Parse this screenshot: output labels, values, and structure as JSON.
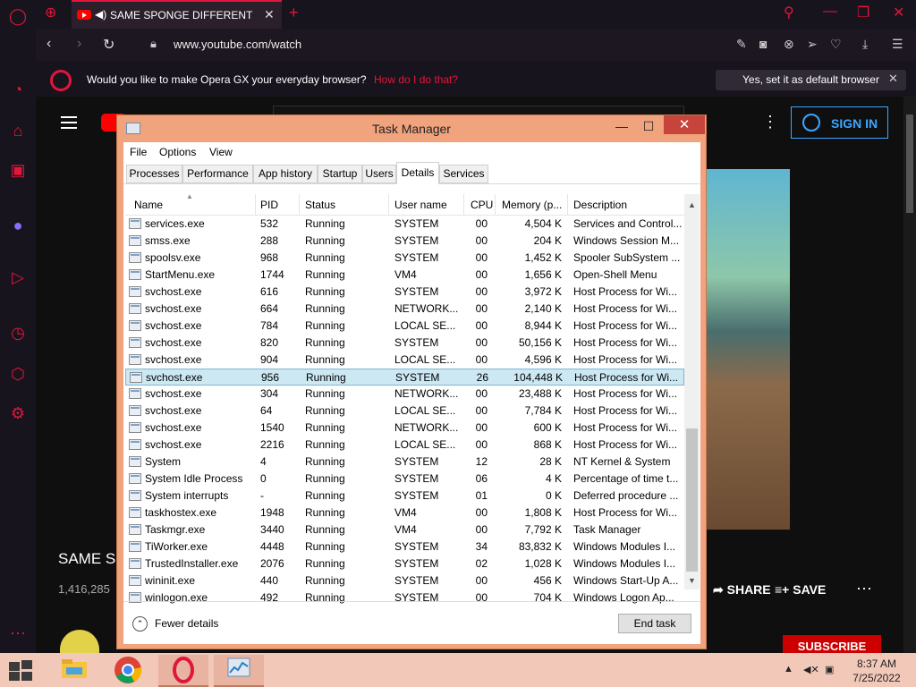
{
  "browser": {
    "tab_title": "SAME SPONGE DIFFERENT",
    "url": "www.youtube.com/watch",
    "infobar_text": "Would you like to make Opera GX your everyday browser?",
    "infobar_link": "How do I do that?",
    "infobar_button": "Yes, set it as default browser"
  },
  "youtube": {
    "signin": "SIGN IN",
    "video_title": "SAME S",
    "views": "1,416,285",
    "share": "SHARE",
    "save": "SAVE",
    "subscribe": "SUBSCRIBE"
  },
  "taskmanager": {
    "title": "Task Manager",
    "menus": [
      "File",
      "Options",
      "View"
    ],
    "tabs": [
      "Processes",
      "Performance",
      "App history",
      "Startup",
      "Users",
      "Details",
      "Services"
    ],
    "active_tab": "Details",
    "columns": [
      "Name",
      "PID",
      "Status",
      "User name",
      "CPU",
      "Memory (p...",
      "Description"
    ],
    "rows": [
      [
        "services.exe",
        "532",
        "Running",
        "SYSTEM",
        "00",
        "4,504 K",
        "Services and Control..."
      ],
      [
        "smss.exe",
        "288",
        "Running",
        "SYSTEM",
        "00",
        "204 K",
        "Windows Session M..."
      ],
      [
        "spoolsv.exe",
        "968",
        "Running",
        "SYSTEM",
        "00",
        "1,452 K",
        "Spooler SubSystem ..."
      ],
      [
        "StartMenu.exe",
        "1744",
        "Running",
        "VM4",
        "00",
        "1,656 K",
        "Open-Shell Menu"
      ],
      [
        "svchost.exe",
        "616",
        "Running",
        "SYSTEM",
        "00",
        "3,972 K",
        "Host Process for Wi..."
      ],
      [
        "svchost.exe",
        "664",
        "Running",
        "NETWORK...",
        "00",
        "2,140 K",
        "Host Process for Wi..."
      ],
      [
        "svchost.exe",
        "784",
        "Running",
        "LOCAL SE...",
        "00",
        "8,944 K",
        "Host Process for Wi..."
      ],
      [
        "svchost.exe",
        "820",
        "Running",
        "SYSTEM",
        "00",
        "50,156 K",
        "Host Process for Wi..."
      ],
      [
        "svchost.exe",
        "904",
        "Running",
        "LOCAL SE...",
        "00",
        "4,596 K",
        "Host Process for Wi..."
      ],
      [
        "svchost.exe",
        "956",
        "Running",
        "SYSTEM",
        "26",
        "104,448 K",
        "Host Process for Wi..."
      ],
      [
        "svchost.exe",
        "304",
        "Running",
        "NETWORK...",
        "00",
        "23,488 K",
        "Host Process for Wi..."
      ],
      [
        "svchost.exe",
        "64",
        "Running",
        "LOCAL SE...",
        "00",
        "7,784 K",
        "Host Process for Wi..."
      ],
      [
        "svchost.exe",
        "1540",
        "Running",
        "NETWORK...",
        "00",
        "600 K",
        "Host Process for Wi..."
      ],
      [
        "svchost.exe",
        "2216",
        "Running",
        "LOCAL SE...",
        "00",
        "868 K",
        "Host Process for Wi..."
      ],
      [
        "System",
        "4",
        "Running",
        "SYSTEM",
        "12",
        "28 K",
        "NT Kernel & System"
      ],
      [
        "System Idle Process",
        "0",
        "Running",
        "SYSTEM",
        "06",
        "4 K",
        "Percentage of time t..."
      ],
      [
        "System interrupts",
        "-",
        "Running",
        "SYSTEM",
        "01",
        "0 K",
        "Deferred procedure ..."
      ],
      [
        "taskhostex.exe",
        "1948",
        "Running",
        "VM4",
        "00",
        "1,808 K",
        "Host Process for Wi..."
      ],
      [
        "Taskmgr.exe",
        "3440",
        "Running",
        "VM4",
        "00",
        "7,792 K",
        "Task Manager"
      ],
      [
        "TiWorker.exe",
        "4448",
        "Running",
        "SYSTEM",
        "34",
        "83,832 K",
        "Windows Modules I..."
      ],
      [
        "TrustedInstaller.exe",
        "2076",
        "Running",
        "SYSTEM",
        "02",
        "1,028 K",
        "Windows Modules I..."
      ],
      [
        "wininit.exe",
        "440",
        "Running",
        "SYSTEM",
        "00",
        "456 K",
        "Windows Start-Up A..."
      ],
      [
        "winlogon.exe",
        "492",
        "Running",
        "SYSTEM",
        "00",
        "704 K",
        "Windows Logon Ap..."
      ]
    ],
    "fewer_details": "Fewer details",
    "end_task": "End task"
  },
  "clock": {
    "time": "8:37 AM",
    "date": "7/25/2022"
  },
  "colors": {
    "opera_accent": "#e0163c",
    "taskbar": "#f2c8b8",
    "tm_frame": "#f0a37d",
    "selected_row": "#cce8f3"
  }
}
